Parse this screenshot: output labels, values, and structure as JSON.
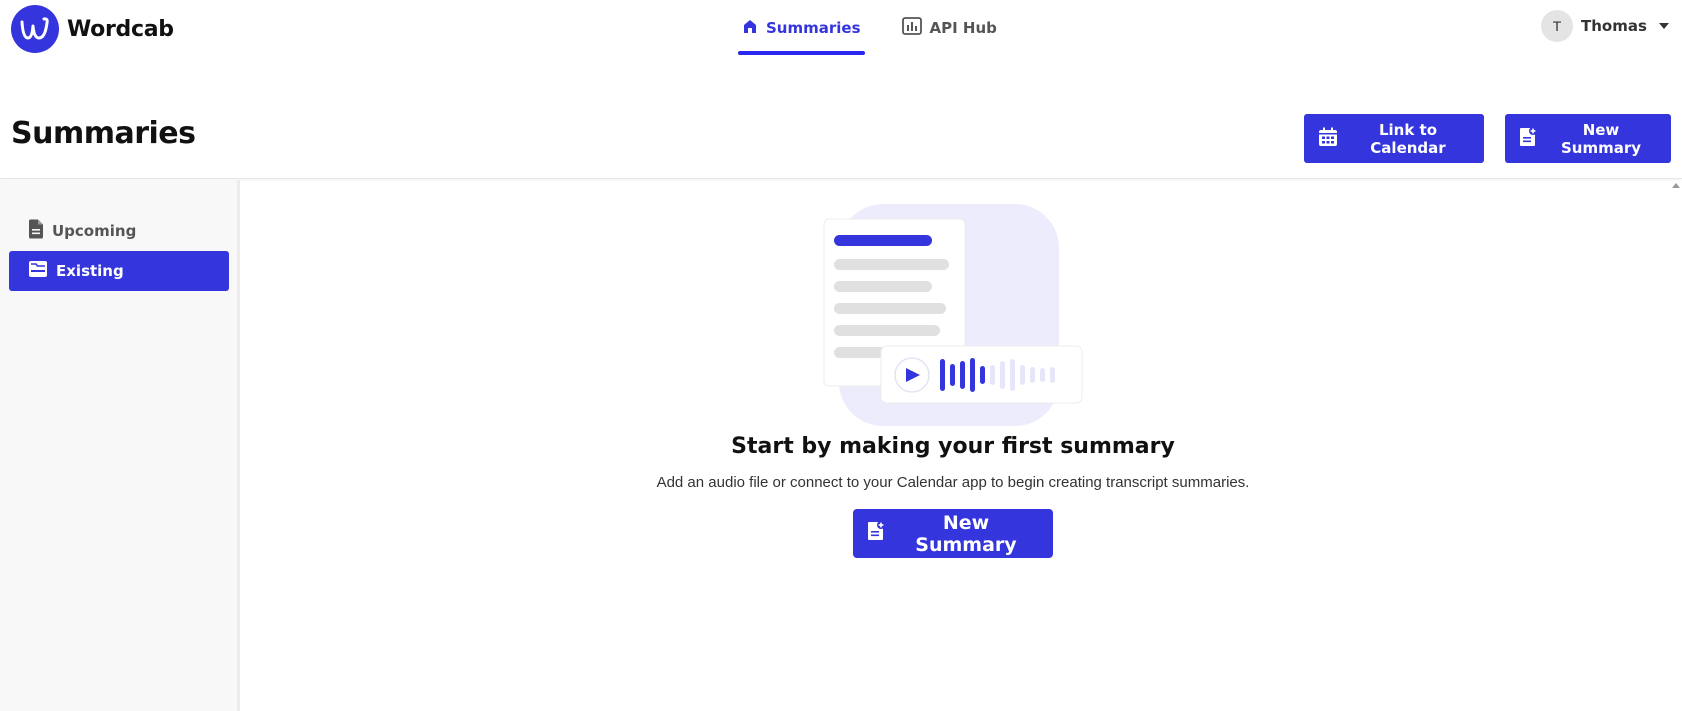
{
  "brand": {
    "name": "Wordcab",
    "color": "#3535dd"
  },
  "nav": {
    "items": [
      {
        "label": "Summaries",
        "icon": "home-icon",
        "active": true
      },
      {
        "label": "API Hub",
        "icon": "bar-chart-icon",
        "active": false
      }
    ]
  },
  "user": {
    "initial": "T",
    "name": "Thomas"
  },
  "header": {
    "title": "Summaries",
    "link_calendar_label": "Link to Calendar",
    "new_summary_label": "New Summary"
  },
  "sidebar": {
    "items": [
      {
        "label": "Upcoming",
        "icon": "document-icon",
        "active": false
      },
      {
        "label": "Existing",
        "icon": "folder-icon",
        "active": true
      }
    ]
  },
  "empty_state": {
    "title": "Start by making your first summary",
    "description": "Add an audio file or connect to your Calendar app to begin creating transcript summaries.",
    "button_label": "New Summary"
  }
}
